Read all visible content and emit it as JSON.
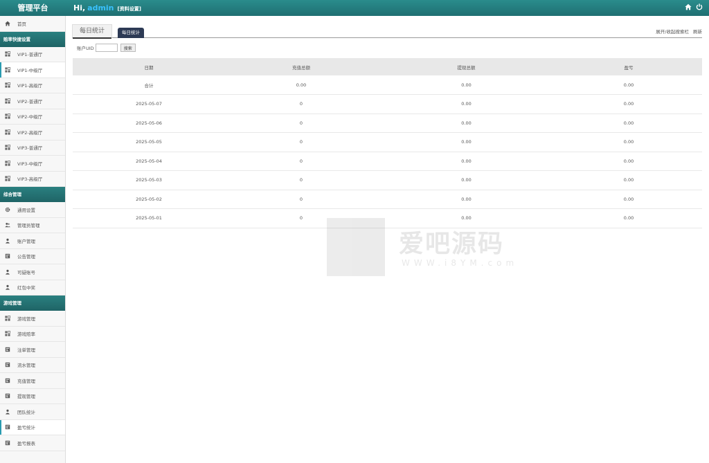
{
  "header": {
    "brand": "管理平台",
    "greeting": "Hi,",
    "username": "admin",
    "profile_link": "[资料设置]",
    "icons": [
      "home-icon",
      "power-icon"
    ]
  },
  "sidebar": {
    "home": {
      "label": "首页",
      "icon": "home-icon"
    },
    "sections": [
      {
        "title": "赔率快捷设置",
        "items": [
          {
            "label": "VIP1-普通厅",
            "icon": "grid-icon",
            "active": false
          },
          {
            "label": "VIP1-中级厅",
            "icon": "grid-icon",
            "active": true
          },
          {
            "label": "VIP1-高级厅",
            "icon": "grid-icon",
            "active": false
          },
          {
            "label": "VIP2-普通厅",
            "icon": "grid-icon",
            "active": false
          },
          {
            "label": "VIP2-中级厅",
            "icon": "grid-icon",
            "active": false
          },
          {
            "label": "VIP2-高级厅",
            "icon": "grid-icon",
            "active": false
          },
          {
            "label": "VIP3-普通厅",
            "icon": "grid-icon",
            "active": false
          },
          {
            "label": "VIP3-中级厅",
            "icon": "grid-icon",
            "active": false
          },
          {
            "label": "VIP3-高级厅",
            "icon": "grid-icon",
            "active": false
          }
        ]
      },
      {
        "title": "综合管理",
        "items": [
          {
            "label": "通用设置",
            "icon": "gear-icon",
            "active": false
          },
          {
            "label": "管理员管理",
            "icon": "users-icon",
            "active": false
          },
          {
            "label": "账户管理",
            "icon": "user-icon",
            "active": false
          },
          {
            "label": "公告管理",
            "icon": "document-icon",
            "active": false
          },
          {
            "label": "可疑账号",
            "icon": "user-icon",
            "active": false
          },
          {
            "label": "红包中奖",
            "icon": "user-icon",
            "active": false
          }
        ]
      },
      {
        "title": "游戏管理",
        "items": [
          {
            "label": "游戏管理",
            "icon": "grid-icon",
            "active": false
          },
          {
            "label": "游戏赔率",
            "icon": "grid-icon",
            "active": false
          },
          {
            "label": "注单管理",
            "icon": "document-icon",
            "active": false
          },
          {
            "label": "流水管理",
            "icon": "document-icon",
            "active": false
          },
          {
            "label": "充值管理",
            "icon": "document-icon",
            "active": false
          },
          {
            "label": "提现管理",
            "icon": "document-icon",
            "active": false
          },
          {
            "label": "团队统计",
            "icon": "user-icon",
            "active": false
          },
          {
            "label": "盈亏统计",
            "icon": "document-icon",
            "active": true
          },
          {
            "label": "盈亏报表",
            "icon": "document-icon",
            "active": false
          }
        ]
      }
    ]
  },
  "main": {
    "tab_title": "每日统计",
    "tab_pill": "每日统计",
    "toggle_search": "展开/收起搜索栏",
    "refresh": "刷新",
    "filter": {
      "label": "账户UID",
      "value": "",
      "button": "搜索"
    },
    "table": {
      "headers": [
        "日期",
        "充值总额",
        "提现总额",
        "盈亏"
      ],
      "rows": [
        [
          "合计",
          "0.00",
          "0.00",
          "0.00"
        ],
        [
          "2025-05-07",
          "0",
          "0.00",
          "0.00"
        ],
        [
          "2025-05-06",
          "0",
          "0.00",
          "0.00"
        ],
        [
          "2025-05-05",
          "0",
          "0.00",
          "0.00"
        ],
        [
          "2025-05-04",
          "0",
          "0.00",
          "0.00"
        ],
        [
          "2025-05-03",
          "0",
          "0.00",
          "0.00"
        ],
        [
          "2025-05-02",
          "0",
          "0.00",
          "0.00"
        ],
        [
          "2025-05-01",
          "0",
          "0.00",
          "0.00"
        ]
      ]
    }
  },
  "watermark": {
    "title": "爱吧源码",
    "url": "WWW.i8YM.com"
  },
  "colors": {
    "header": "#1f6f72",
    "section": "#1f6466",
    "accent": "#2a9bb0",
    "username": "#39c2ff",
    "pill": "#2d3a55"
  }
}
